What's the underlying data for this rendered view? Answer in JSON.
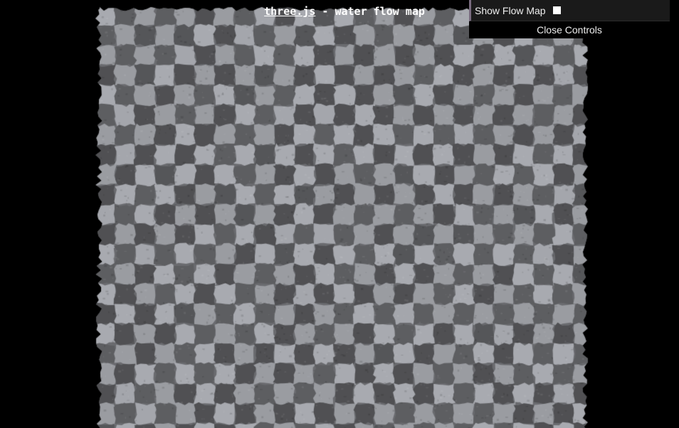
{
  "info": {
    "link_text": "three.js",
    "title_rest": " - water flow map"
  },
  "gui": {
    "controllers": [
      {
        "label": "Show Flow Map",
        "checked": false
      }
    ],
    "close_label": "Close Controls"
  },
  "scene": {
    "background": "#000000",
    "dark_tile_color": "#555659",
    "light_tile_color": "#a4a6ac",
    "texture_icon": "checkerboard-water-texture"
  }
}
